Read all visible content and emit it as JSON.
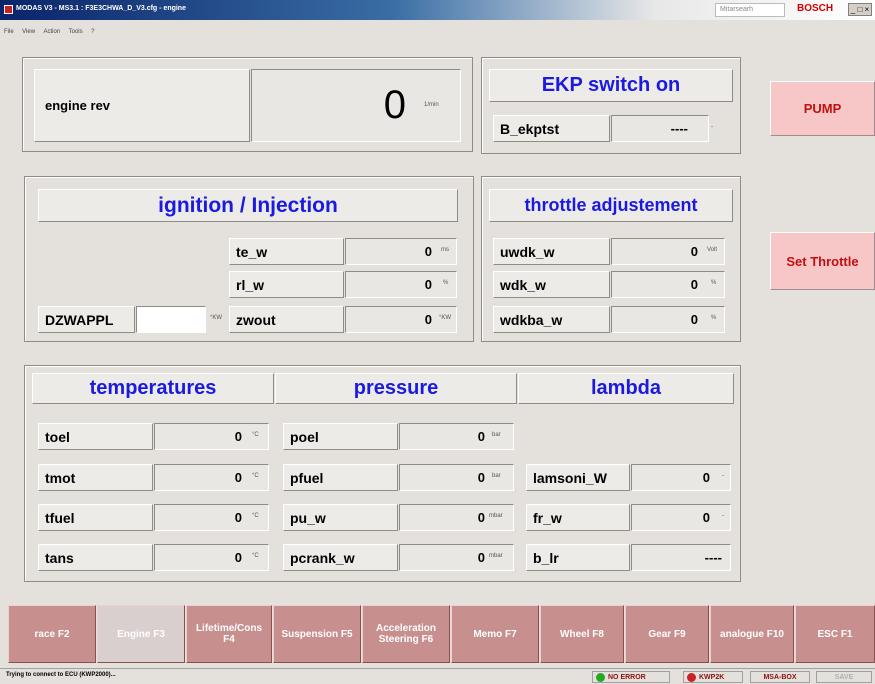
{
  "window": {
    "title": "MODAS V3 - MS3.1 : F3E3CHWA_D_V3.cfg - engine",
    "search_text": "Mitarsearh",
    "brand": "BOSCH",
    "window_buttons": "_ □ ×"
  },
  "menu": [
    "File",
    "View",
    "Action",
    "Tools",
    "?"
  ],
  "engine": {
    "label": "engine rev",
    "value": "0",
    "unit": "1/min"
  },
  "ekp": {
    "header": "EKP switch on",
    "label": "B_ekptst",
    "value": "----",
    "unit": "-"
  },
  "side_buttons": {
    "pump": "PUMP",
    "set_throttle": "Set Throttle"
  },
  "ignition": {
    "header": "ignition / Injection",
    "rows": [
      {
        "label": "te_w",
        "value": "0",
        "unit": "ms"
      },
      {
        "label": "rl_w",
        "value": "0",
        "unit": "%"
      },
      {
        "label": "zwout",
        "value": "0",
        "unit": "°KW"
      }
    ],
    "dzwappl": {
      "label": "DZWAPPL",
      "value": "",
      "unit": "°KW"
    }
  },
  "throttle": {
    "header": "throttle adjustement",
    "rows": [
      {
        "label": "uwdk_w",
        "value": "0",
        "unit": "Volt"
      },
      {
        "label": "wdk_w",
        "value": "0",
        "unit": "%"
      },
      {
        "label": "wdkba_w",
        "value": "0",
        "unit": "%"
      }
    ]
  },
  "sections": {
    "temperatures": "temperatures",
    "pressure": "pressure",
    "lambda": "lambda"
  },
  "temperatures": [
    {
      "label": "toel",
      "value": "0",
      "unit": "°C"
    },
    {
      "label": "tmot",
      "value": "0",
      "unit": "°C"
    },
    {
      "label": "tfuel",
      "value": "0",
      "unit": "°C"
    },
    {
      "label": "tans",
      "value": "0",
      "unit": "°C"
    }
  ],
  "pressure": [
    {
      "label": "poel",
      "value": "0",
      "unit": "bar"
    },
    {
      "label": "pfuel",
      "value": "0",
      "unit": "bar"
    },
    {
      "label": "pu_w",
      "value": "0",
      "unit": "mbar"
    },
    {
      "label": "pcrank_w",
      "value": "0",
      "unit": "mbar"
    }
  ],
  "lambda": [
    {
      "label": "lamsoni_W",
      "value": "0",
      "unit": "-"
    },
    {
      "label": "fr_w",
      "value": "0",
      "unit": "-"
    },
    {
      "label": "b_lr",
      "value": "----",
      "unit": ""
    }
  ],
  "tabs": [
    {
      "label": "race F2"
    },
    {
      "label": "Engine F3"
    },
    {
      "label": "Lifetime/Cons F4"
    },
    {
      "label": "Suspension F5"
    },
    {
      "label": "Acceleration Steering F6"
    },
    {
      "label": "Memo F7"
    },
    {
      "label": "Wheel F8"
    },
    {
      "label": "Gear F9"
    },
    {
      "label": "analogue F10"
    },
    {
      "label": "ESC F1"
    }
  ],
  "status": {
    "message": "Trying to connect to ECU (KWP2000)...",
    "no_error": "NO ERROR",
    "kwp": "KWP2K",
    "msa": "MSA-BOX",
    "save": "SAVE"
  },
  "colors": {
    "header_blue": "#1a1ae0",
    "side_button_bg": "#f7c7c7",
    "tab_bg": "#c88f8f",
    "status_green": "#22aa22",
    "status_red": "#cc2222"
  }
}
